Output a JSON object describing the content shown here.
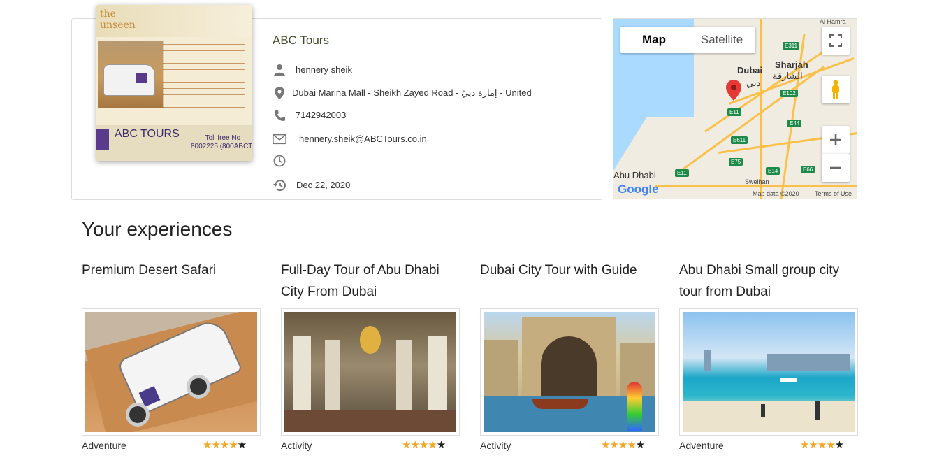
{
  "agency": {
    "logo": {
      "title": "the\nunseen",
      "brand": "ABC TOURS",
      "toll": "Toll free No\n8002225 (800ABCT)"
    },
    "name": "ABC Tours",
    "contact_person": "hennery sheik",
    "address": "Dubai Marina Mall - Sheikh Zayed Road - إمارة دبيّ - United",
    "phone": "7142942003",
    "email": "hennery.sheik@ABCTours.co.in",
    "hours": "",
    "date": "Dec 22, 2020"
  },
  "map": {
    "tabs": [
      "Map",
      "Satellite"
    ],
    "labels": {
      "al_hamra": "Al Hamra",
      "sharjah": "Sharjah",
      "sharjah_ar": "الشارقة",
      "dubai": "Dubai",
      "dubai_ar": "دبي",
      "abu_dhabi": "Abu Dhabi",
      "sweihan": "Sweihan",
      "attribution": "Map data ©2020",
      "terms": "Terms of Use",
      "google": "Google"
    },
    "shields": [
      "E311",
      "E102",
      "E11",
      "E44",
      "E611",
      "E75",
      "E11",
      "E14",
      "E66"
    ]
  },
  "experiences": {
    "heading": "Your experiences",
    "items": [
      {
        "title": "Premium Desert Safari",
        "category": "Adventure",
        "rating": 4
      },
      {
        "title": "Full-Day Tour of Abu Dhabi City From Dubai",
        "category": "Activity",
        "rating": 4
      },
      {
        "title": "Dubai City Tour with Guide",
        "category": "Activity",
        "rating": 4
      },
      {
        "title": "Abu Dhabi Small group city tour from Dubai",
        "category": "Adventure",
        "rating": 4
      }
    ]
  }
}
